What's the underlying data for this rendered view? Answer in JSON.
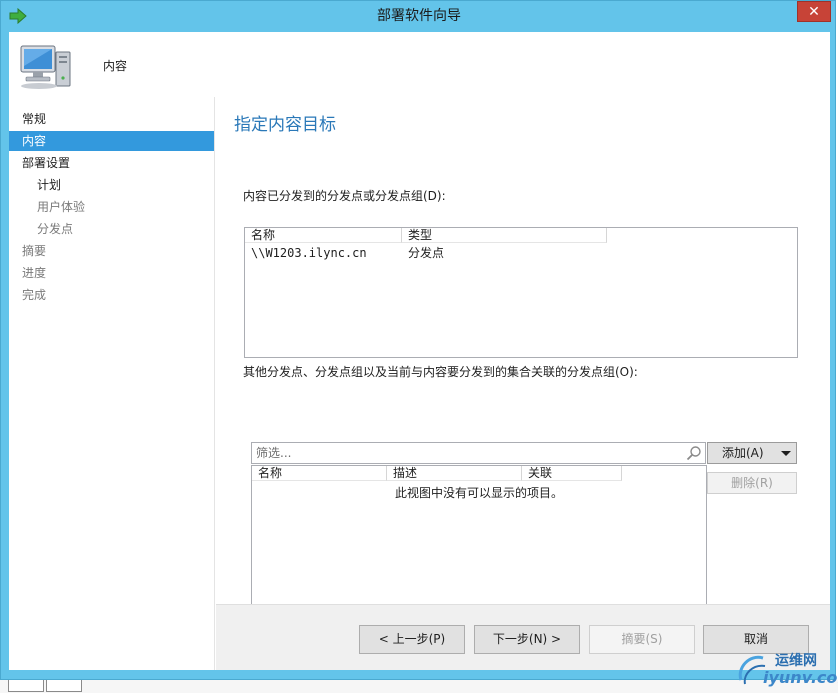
{
  "window": {
    "title": "部署软件向导",
    "close_glyph": "✕"
  },
  "header": {
    "title": "内容"
  },
  "sidebar": {
    "items": [
      {
        "label": "常规"
      },
      {
        "label": "内容"
      },
      {
        "label": "部署设置"
      },
      {
        "label": "计划"
      },
      {
        "label": "用户体验"
      },
      {
        "label": "分发点"
      },
      {
        "label": "摘要"
      },
      {
        "label": "进度"
      },
      {
        "label": "完成"
      }
    ]
  },
  "main": {
    "page_title": "指定内容目标",
    "distributed_label": "内容已分发到的分发点或分发点组(D):",
    "distributed_list": {
      "columns": [
        "名称",
        "类型"
      ],
      "rows": [
        {
          "name": "\\\\W1203.ilync.cn",
          "type": "分发点"
        }
      ]
    },
    "other_label": "其他分发点、分发点组以及当前与内容要分发到的集合关联的分发点组(O):",
    "filter_placeholder": "筛选...",
    "other_list": {
      "columns": [
        "名称",
        "描述",
        "关联"
      ],
      "empty_text": "此视图中没有可以显示的项目。"
    },
    "add_button": "添加(A)",
    "remove_button": "删除(R)"
  },
  "footer": {
    "prev_button": "< 上一步(P)",
    "next_button": "下一步(N) >",
    "summary_button": "摘要(S)",
    "cancel_button": "取消"
  },
  "watermark": {
    "cn": "运维网",
    "en": "iyunv.com"
  },
  "colors": {
    "titlebar": "#63c4ea",
    "nav_active": "#3399dd",
    "page_title": "#2a78b8",
    "close": "#c74337"
  }
}
